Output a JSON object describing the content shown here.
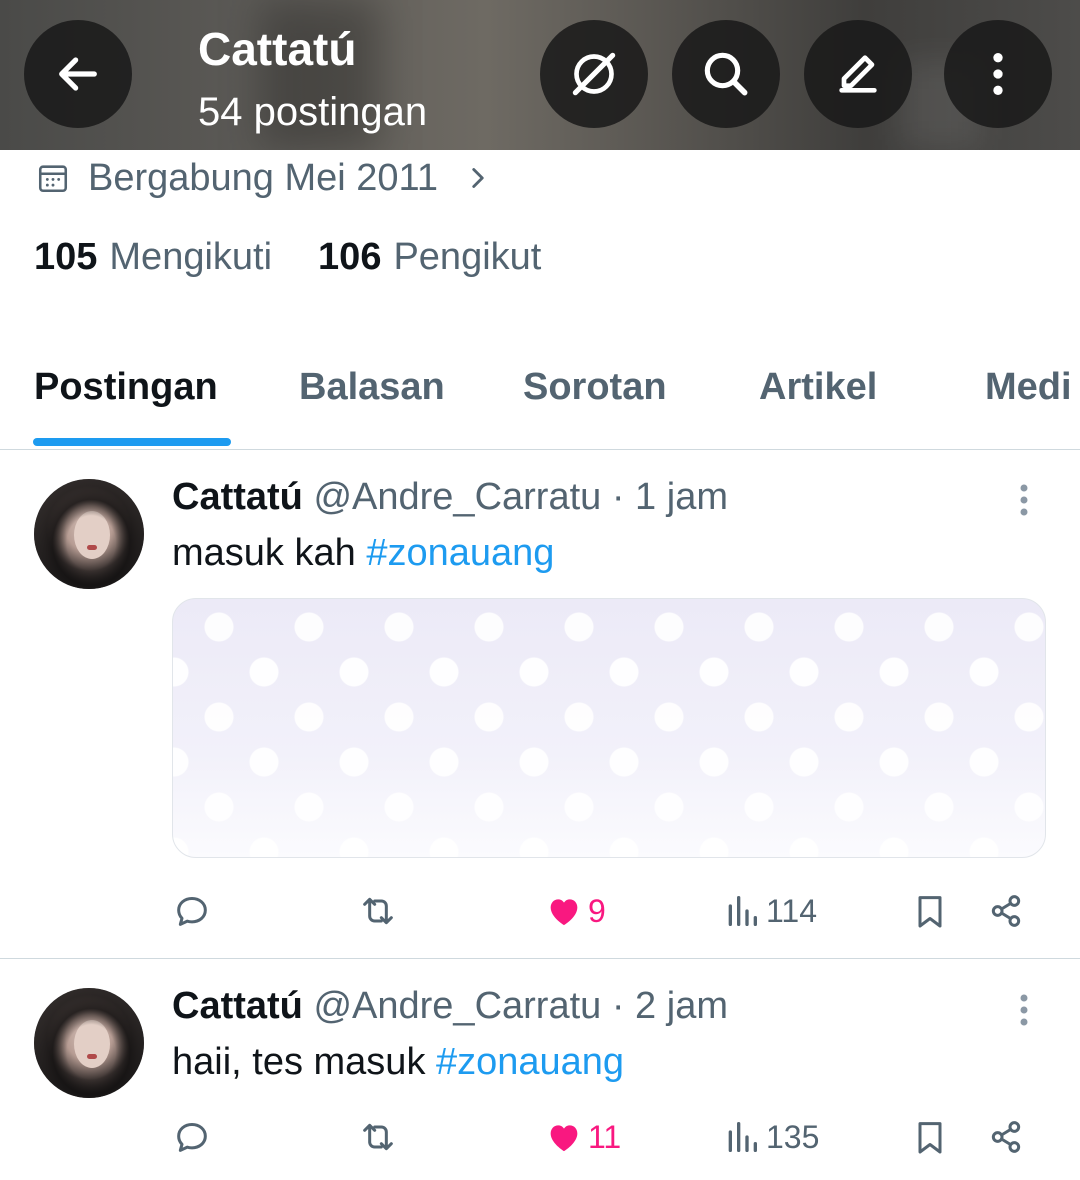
{
  "header": {
    "title": "Cattatú",
    "subtitle": "54 postingan",
    "icons": [
      "back-arrow-icon",
      "grok-icon",
      "search-icon",
      "edit-icon",
      "more-vertical-icon"
    ]
  },
  "profile": {
    "joined": "Bergabung Mei 2011",
    "following_count": "105",
    "following_label": "Mengikuti",
    "followers_count": "106",
    "followers_label": "Pengikut"
  },
  "tabs": [
    {
      "label": "Postingan",
      "active": true
    },
    {
      "label": "Balasan",
      "active": false
    },
    {
      "label": "Sorotan",
      "active": false
    },
    {
      "label": "Artikel",
      "active": false
    },
    {
      "label": "Medi",
      "active": false
    }
  ],
  "colors": {
    "accent": "#1d9bf0",
    "like": "#f91880",
    "muted": "#536471",
    "text": "#0f1419"
  },
  "posts": [
    {
      "name": "Cattatú",
      "handle": "@Andre_Carratu",
      "time": "· 1 jam",
      "text": "masuk kah ",
      "hashtag": "#zonauang",
      "has_media": true,
      "likes": "9",
      "views": "114",
      "liked": true
    },
    {
      "name": "Cattatú",
      "handle": "@Andre_Carratu",
      "time": "· 2 jam",
      "text": "haii, tes masuk ",
      "hashtag": "#zonauang",
      "has_media": false,
      "likes": "11",
      "views": "135",
      "liked": true
    }
  ]
}
